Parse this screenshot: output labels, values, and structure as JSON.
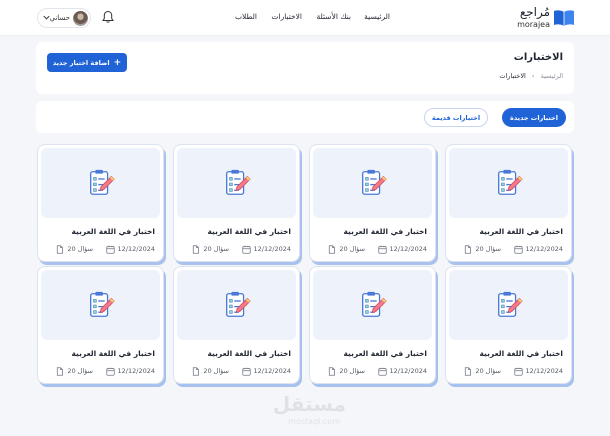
{
  "brand": {
    "name_ar": "مُراجع",
    "name_en": "morajea",
    "accent": "#1f63d6"
  },
  "nav": [
    {
      "label": "الرئيسية"
    },
    {
      "label": "بنك الأسئلة"
    },
    {
      "label": "الاختبارات"
    },
    {
      "label": "الطلاب"
    }
  ],
  "user": {
    "name": "حساني"
  },
  "header": {
    "title": "الاختبارات",
    "breadcrumb_home": "الرئيسية",
    "breadcrumb_sep": "›",
    "breadcrumb_current": "الاختبارات",
    "add_button": "اضافة اختبار جديد"
  },
  "tabs": {
    "new": "اختبارات جديدة",
    "old": "اختبارات قديمة"
  },
  "cards": [
    {
      "title": "اختبار في اللغة العربية",
      "date": "12/12/2024",
      "questions": "20 سؤال"
    },
    {
      "title": "اختبار في اللغة العربية",
      "date": "12/12/2024",
      "questions": "20 سؤال"
    },
    {
      "title": "اختبار في اللغة العربية",
      "date": "12/12/2024",
      "questions": "20 سؤال"
    },
    {
      "title": "اختبار في اللغة العربية",
      "date": "12/12/2024",
      "questions": "20 سؤال"
    },
    {
      "title": "اختبار في اللغة العربية",
      "date": "12/12/2024",
      "questions": "20 سؤال"
    },
    {
      "title": "اختبار في اللغة العربية",
      "date": "12/12/2024",
      "questions": "20 سؤال"
    },
    {
      "title": "اختبار في اللغة العربية",
      "date": "12/12/2024",
      "questions": "20 سؤال"
    },
    {
      "title": "اختبار في اللغة العربية",
      "date": "12/12/2024",
      "questions": "20 سؤال"
    }
  ],
  "watermark": {
    "ar": "مستقل",
    "en": "mostaql.com"
  }
}
